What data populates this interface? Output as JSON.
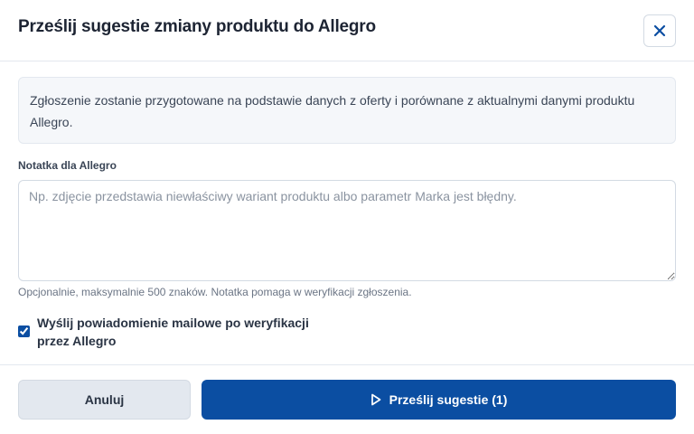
{
  "dialog": {
    "title": "Prześlij sugestie zmiany produktu do Allegro",
    "close_icon": "close-icon"
  },
  "info": {
    "text": "Zgłoszenie zostanie przygotowane na podstawie danych z oferty i porównane z aktualnymi danymi produktu Allegro."
  },
  "note_field": {
    "label": "Notatka dla Allegro",
    "placeholder": "Np. zdjęcie przedstawia niewłaściwy wariant produktu albo parametr Marka jest błędny.",
    "value": "",
    "hint": "Opcjonalnie, maksymalnie 500 znaków. Notatka pomaga w weryfikacji zgłoszenia."
  },
  "email_notification": {
    "label": "Wyślij powiadomienie mailowe po weryfikacji przez Allegro",
    "checked": true
  },
  "footer": {
    "cancel_label": "Anuluj",
    "submit_label": "Prześlij sugestie (1)",
    "submit_icon": "play-icon"
  },
  "colors": {
    "primary": "#0b4ea2",
    "cancel_bg": "#e3e8ef",
    "info_bg": "#f5f7fa"
  }
}
